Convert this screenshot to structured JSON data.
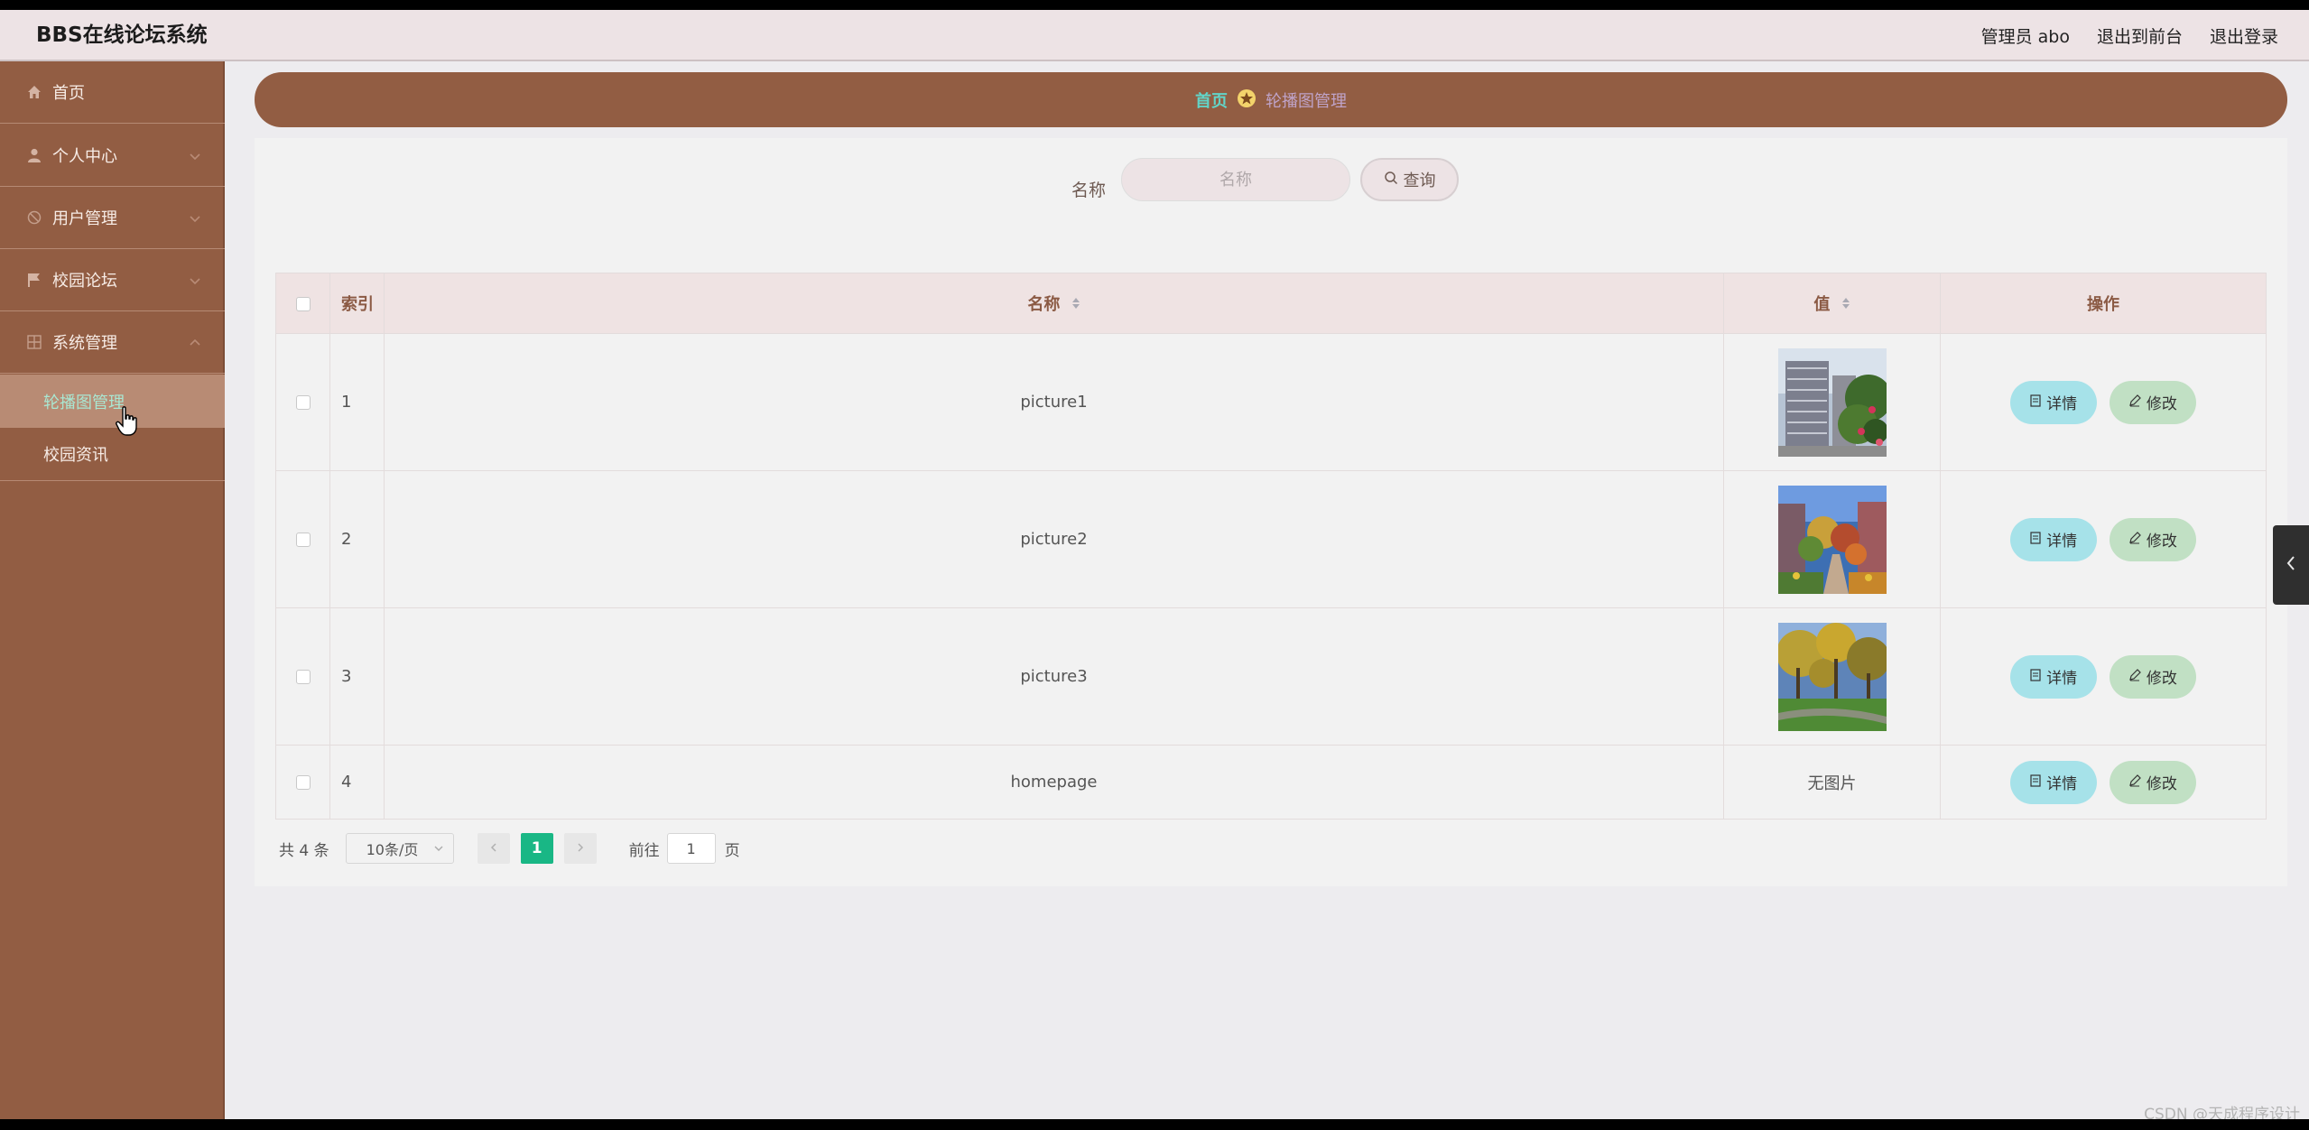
{
  "header": {
    "title": "BBS在线论坛系统",
    "admin": "管理员 abo",
    "to_front": "退出到前台",
    "logout": "退出登录"
  },
  "sidebar": {
    "items": [
      {
        "label": "首页",
        "icon": "home-icon"
      },
      {
        "label": "个人中心",
        "icon": "user-icon"
      },
      {
        "label": "用户管理",
        "icon": "users-icon"
      },
      {
        "label": "校园论坛",
        "icon": "flag-icon"
      },
      {
        "label": "系统管理",
        "icon": "grid-icon"
      }
    ],
    "sub_items": [
      "轮播图管理",
      "校园资讯"
    ]
  },
  "breadcrumb": {
    "home": "首页",
    "current": "轮播图管理"
  },
  "search": {
    "label": "名称",
    "placeholder": "名称",
    "button": "查询"
  },
  "table": {
    "headers": {
      "index": "索引",
      "name": "名称",
      "value": "值",
      "action": "操作"
    },
    "rows": [
      {
        "index": "1",
        "name": "picture1",
        "image": "campus-building-photo"
      },
      {
        "index": "2",
        "name": "picture2",
        "image": "campus-garden-photo"
      },
      {
        "index": "3",
        "name": "picture3",
        "image": "campus-trees-photo"
      },
      {
        "index": "4",
        "name": "homepage",
        "no_image": "无图片"
      }
    ],
    "detail_label": "详情",
    "edit_label": "修改"
  },
  "pagination": {
    "total": "共 4 条",
    "page_size": "10条/页",
    "current": "1",
    "goto_label": "前往",
    "goto_value": "1",
    "goto_unit": "页"
  },
  "watermark": "CSDN @天成程序设计",
  "colors": {
    "sidebar": "#925d43",
    "accent": "#19b785",
    "detail_button": "#a6e2e9",
    "edit_button": "#c1e0c4"
  }
}
